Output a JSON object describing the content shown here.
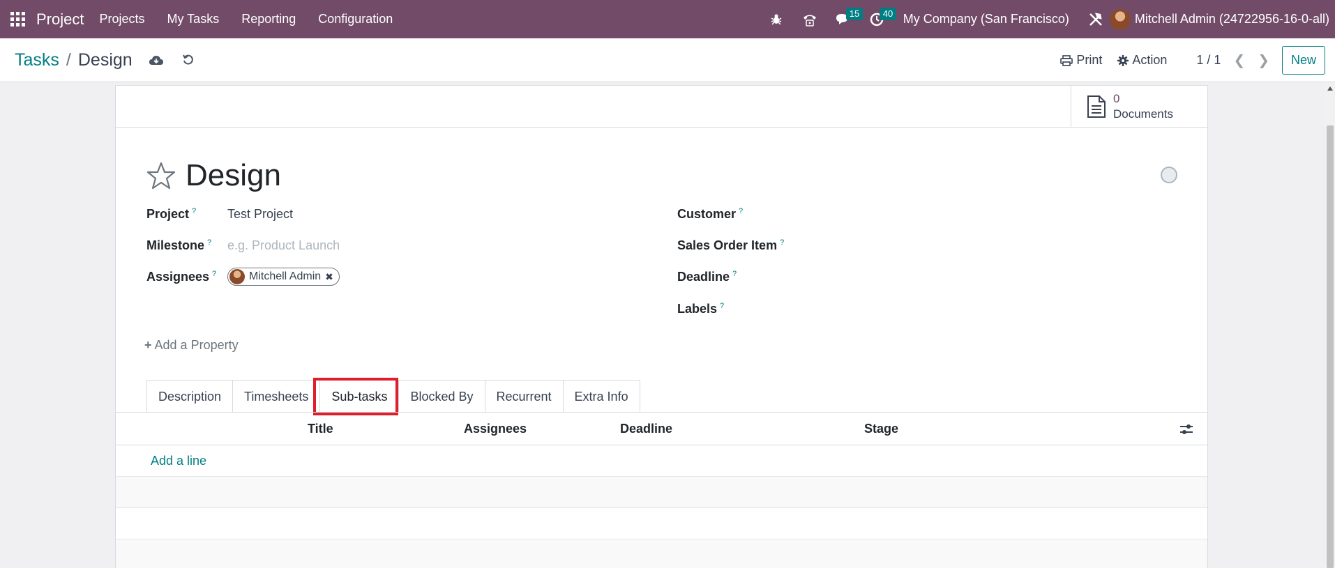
{
  "navbar": {
    "app_name": "Project",
    "menu": [
      "Projects",
      "My Tasks",
      "Reporting",
      "Configuration"
    ],
    "messages_badge": "15",
    "activities_badge": "40",
    "company": "My Company (San Francisco)",
    "user": "Mitchell Admin (24722956-16-0-all)"
  },
  "control_panel": {
    "breadcrumb_parent": "Tasks",
    "breadcrumb_sep": "/",
    "breadcrumb_current": "Design",
    "print_label": "Print",
    "action_label": "Action",
    "pager": "1 / 1",
    "new_label": "New"
  },
  "button_box": {
    "documents_count": "0",
    "documents_label": "Documents"
  },
  "form": {
    "title": "Design",
    "help_mark": "?",
    "fields_left": {
      "project_label": "Project",
      "project_value": "Test Project",
      "milestone_label": "Milestone",
      "milestone_placeholder": "e.g. Product Launch",
      "assignees_label": "Assignees",
      "assignee_tag": "Mitchell Admin"
    },
    "fields_right": {
      "customer_label": "Customer",
      "sale_line_label": "Sales Order Item",
      "deadline_label": "Deadline",
      "labels_label": "Labels"
    },
    "add_property": "Add a Property"
  },
  "tabs": [
    "Description",
    "Timesheets",
    "Sub-tasks",
    "Blocked By",
    "Recurrent",
    "Extra Info"
  ],
  "active_tab": "Sub-tasks",
  "subtasks_list": {
    "columns": [
      "Title",
      "Assignees",
      "Deadline",
      "Stage"
    ],
    "add_line": "Add a line"
  },
  "colors": {
    "navbar": "#714b67",
    "accent": "#017e84",
    "highlight": "#e01d2a"
  }
}
